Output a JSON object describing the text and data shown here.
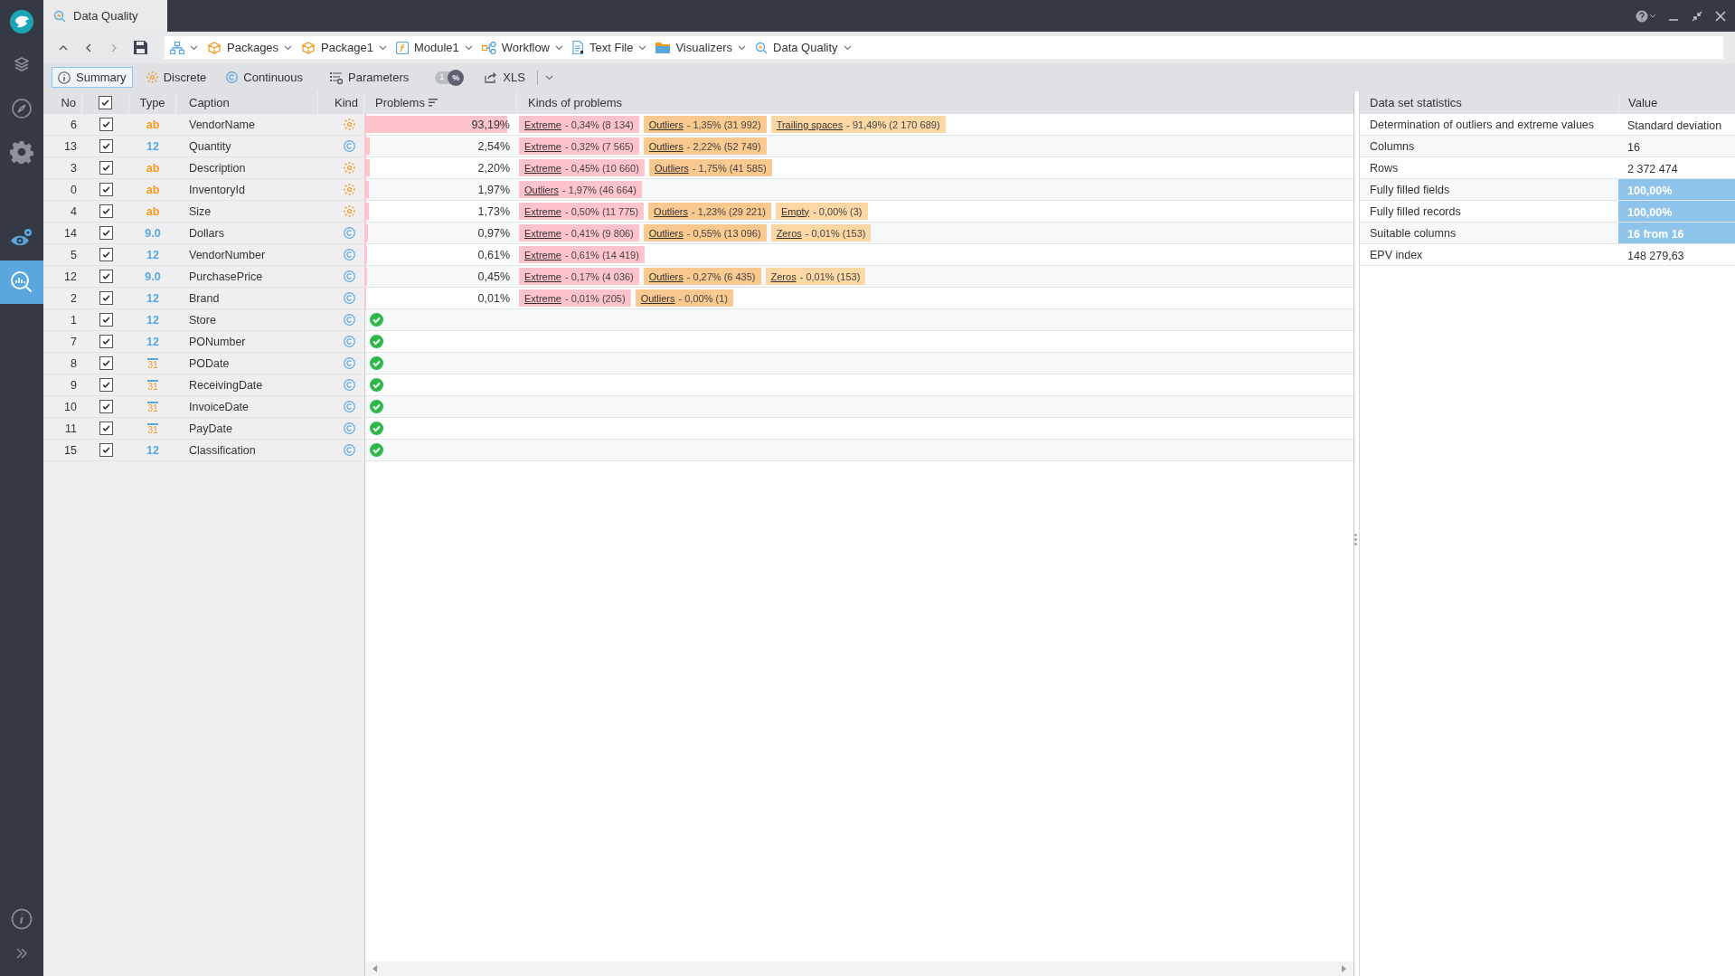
{
  "window": {
    "tab_title": "Data Quality"
  },
  "sidebar": {
    "items": [
      {
        "kind": "logo",
        "selected": false
      },
      {
        "kind": "layers",
        "selected": false
      },
      {
        "kind": "compass",
        "selected": false
      },
      {
        "kind": "gear",
        "selected": false
      },
      {
        "kind": "eye",
        "selected": false
      },
      {
        "kind": "analysis",
        "selected": true
      }
    ],
    "bottom_items": [
      {
        "kind": "info",
        "selected": false
      },
      {
        "kind": "expand",
        "selected": false
      }
    ]
  },
  "breadcrumbs": [
    {
      "kind": "tree"
    },
    {
      "kind": "package",
      "label": "Packages"
    },
    {
      "kind": "package",
      "label": "Package1"
    },
    {
      "kind": "module",
      "label": "Module1"
    },
    {
      "kind": "workflow",
      "label": "Workflow"
    },
    {
      "kind": "file",
      "label": "Text File"
    },
    {
      "kind": "folder",
      "label": "Visualizers"
    },
    {
      "kind": "quality",
      "label": "Data Quality"
    }
  ],
  "toolbar": {
    "tabs": [
      {
        "kind": "info",
        "label": "Summary",
        "selected": true
      },
      {
        "kind": "discrete",
        "label": "Discrete",
        "selected": false
      },
      {
        "kind": "continuous",
        "label": "Continuous",
        "selected": false
      }
    ],
    "parameters": {
      "label": "Parameters"
    },
    "percent_toggle": {
      "on": true,
      "off_label": "1",
      "on_label": "%"
    },
    "export": {
      "label": "XLS"
    }
  },
  "table": {
    "columns": [
      "No",
      "Type",
      "Caption",
      "Kind",
      "Problems",
      "Kinds of problems"
    ],
    "select_all": {
      "checked": true
    },
    "rows": [
      {
        "no": "6",
        "checked": true,
        "type": {
          "kind": "text",
          "label": "ab"
        },
        "caption": "VendorName",
        "kind": "discrete",
        "ok": false,
        "problems": "93,19%",
        "level": 0.9319,
        "issues": [
          {
            "name": "Extreme",
            "detail": "- 0,34% (8 134)",
            "color": "#ffc3cc"
          },
          {
            "name": "Outliers",
            "detail": "- 1,35% (31 992)",
            "color": "#fac98f"
          },
          {
            "name": "Trailing spaces",
            "detail": "- 91,49% (2 170 689)",
            "color": "#fdd8a5"
          }
        ]
      },
      {
        "no": "13",
        "checked": true,
        "type": {
          "kind": "integer",
          "label": "12"
        },
        "caption": "Quantity",
        "kind": "continuous",
        "ok": false,
        "problems": "2,54%",
        "level": 0.0254,
        "issues": [
          {
            "name": "Extreme",
            "detail": "- 0,32% (7 565)",
            "color": "#ffc3cc"
          },
          {
            "name": "Outliers",
            "detail": "- 2,22% (52 749)",
            "color": "#fac98f"
          }
        ]
      },
      {
        "no": "3",
        "checked": true,
        "type": {
          "kind": "text",
          "label": "ab"
        },
        "caption": "Description",
        "kind": "discrete",
        "ok": false,
        "problems": "2,20%",
        "level": 0.022,
        "issues": [
          {
            "name": "Extreme",
            "detail": "- 0,45% (10 660)",
            "color": "#ffc3cc"
          },
          {
            "name": "Outliers",
            "detail": "- 1,75% (41 585)",
            "color": "#fac98f"
          }
        ]
      },
      {
        "no": "0",
        "checked": true,
        "type": {
          "kind": "text",
          "label": "ab"
        },
        "caption": "InventoryId",
        "kind": "discrete",
        "ok": false,
        "problems": "1,97%",
        "level": 0.0197,
        "issues": [
          {
            "name": "Outliers",
            "detail": "- 1,97% (46 664)",
            "color": "#ffc3cc"
          }
        ]
      },
      {
        "no": "4",
        "checked": true,
        "type": {
          "kind": "text",
          "label": "ab"
        },
        "caption": "Size",
        "kind": "discrete",
        "ok": false,
        "problems": "1,73%",
        "level": 0.0173,
        "issues": [
          {
            "name": "Extreme",
            "detail": "- 0,50% (11 775)",
            "color": "#ffc3cc"
          },
          {
            "name": "Outliers",
            "detail": "- 1,23% (29 221)",
            "color": "#fac98f"
          },
          {
            "name": "Empty",
            "detail": "- 0,00% (3)",
            "color": "#fdd8a5"
          }
        ]
      },
      {
        "no": "14",
        "checked": true,
        "type": {
          "kind": "float",
          "label": "9.0"
        },
        "caption": "Dollars",
        "kind": "continuous",
        "ok": false,
        "problems": "0,97%",
        "level": 0.0097,
        "issues": [
          {
            "name": "Extreme",
            "detail": "- 0,41% (9 806)",
            "color": "#ffc3cc"
          },
          {
            "name": "Outliers",
            "detail": "- 0,55% (13 096)",
            "color": "#fac98f"
          },
          {
            "name": "Zeros",
            "detail": "- 0,01% (153)",
            "color": "#fdd8a5"
          }
        ]
      },
      {
        "no": "5",
        "checked": true,
        "type": {
          "kind": "integer",
          "label": "12"
        },
        "caption": "VendorNumber",
        "kind": "continuous",
        "ok": false,
        "problems": "0,61%",
        "level": 0.0061,
        "issues": [
          {
            "name": "Extreme",
            "detail": "- 0,61% (14 419)",
            "color": "#ffc3cc"
          }
        ]
      },
      {
        "no": "12",
        "checked": true,
        "type": {
          "kind": "float",
          "label": "9.0"
        },
        "caption": "PurchasePrice",
        "kind": "continuous",
        "ok": false,
        "problems": "0,45%",
        "level": 0.0045,
        "issues": [
          {
            "name": "Extreme",
            "detail": "- 0,17% (4 036)",
            "color": "#ffc3cc"
          },
          {
            "name": "Outliers",
            "detail": "- 0,27% (6 435)",
            "color": "#fac98f"
          },
          {
            "name": "Zeros",
            "detail": "- 0,01% (153)",
            "color": "#fdd8a5"
          }
        ]
      },
      {
        "no": "2",
        "checked": true,
        "type": {
          "kind": "integer",
          "label": "12"
        },
        "caption": "Brand",
        "kind": "continuous",
        "ok": false,
        "problems": "0,01%",
        "level": 0.0001,
        "issues": [
          {
            "name": "Extreme",
            "detail": "- 0,01% (205)",
            "color": "#ffc3cc"
          },
          {
            "name": "Outliers",
            "detail": "- 0,00% (1)",
            "color": "#fac98f"
          }
        ]
      },
      {
        "no": "1",
        "checked": true,
        "type": {
          "kind": "integer",
          "label": "12"
        },
        "caption": "Store",
        "kind": "continuous",
        "ok": true
      },
      {
        "no": "7",
        "checked": true,
        "type": {
          "kind": "integer",
          "label": "12"
        },
        "caption": "PONumber",
        "kind": "continuous",
        "ok": true
      },
      {
        "no": "8",
        "checked": true,
        "type": {
          "kind": "date",
          "label": "31"
        },
        "caption": "PODate",
        "kind": "continuous",
        "ok": true
      },
      {
        "no": "9",
        "checked": true,
        "type": {
          "kind": "date",
          "label": "31"
        },
        "caption": "ReceivingDate",
        "kind": "continuous",
        "ok": true
      },
      {
        "no": "10",
        "checked": true,
        "type": {
          "kind": "date",
          "label": "31"
        },
        "caption": "InvoiceDate",
        "kind": "continuous",
        "ok": true
      },
      {
        "no": "11",
        "checked": true,
        "type": {
          "kind": "date",
          "label": "31"
        },
        "caption": "PayDate",
        "kind": "continuous",
        "ok": true
      },
      {
        "no": "15",
        "checked": true,
        "type": {
          "kind": "integer",
          "label": "12"
        },
        "caption": "Classification",
        "kind": "continuous",
        "ok": true
      }
    ]
  },
  "statistics": {
    "columns": [
      "Data set statistics",
      "Value"
    ],
    "rows": [
      {
        "label": "Determination of outliers and extreme values",
        "value": "Standard deviation",
        "highlight": false
      },
      {
        "label": "Columns",
        "value": "16",
        "highlight": false
      },
      {
        "label": "Rows",
        "value": "2 372 474",
        "highlight": false
      },
      {
        "label": "Fully filled fields",
        "value": "100,00%",
        "highlight": true
      },
      {
        "label": "Fully filled records",
        "value": "100,00%",
        "highlight": true
      },
      {
        "label": "Suitable columns",
        "value": "16 from 16",
        "highlight": true
      },
      {
        "label": "EPV index",
        "value": "148 279,63",
        "highlight": false
      }
    ]
  }
}
